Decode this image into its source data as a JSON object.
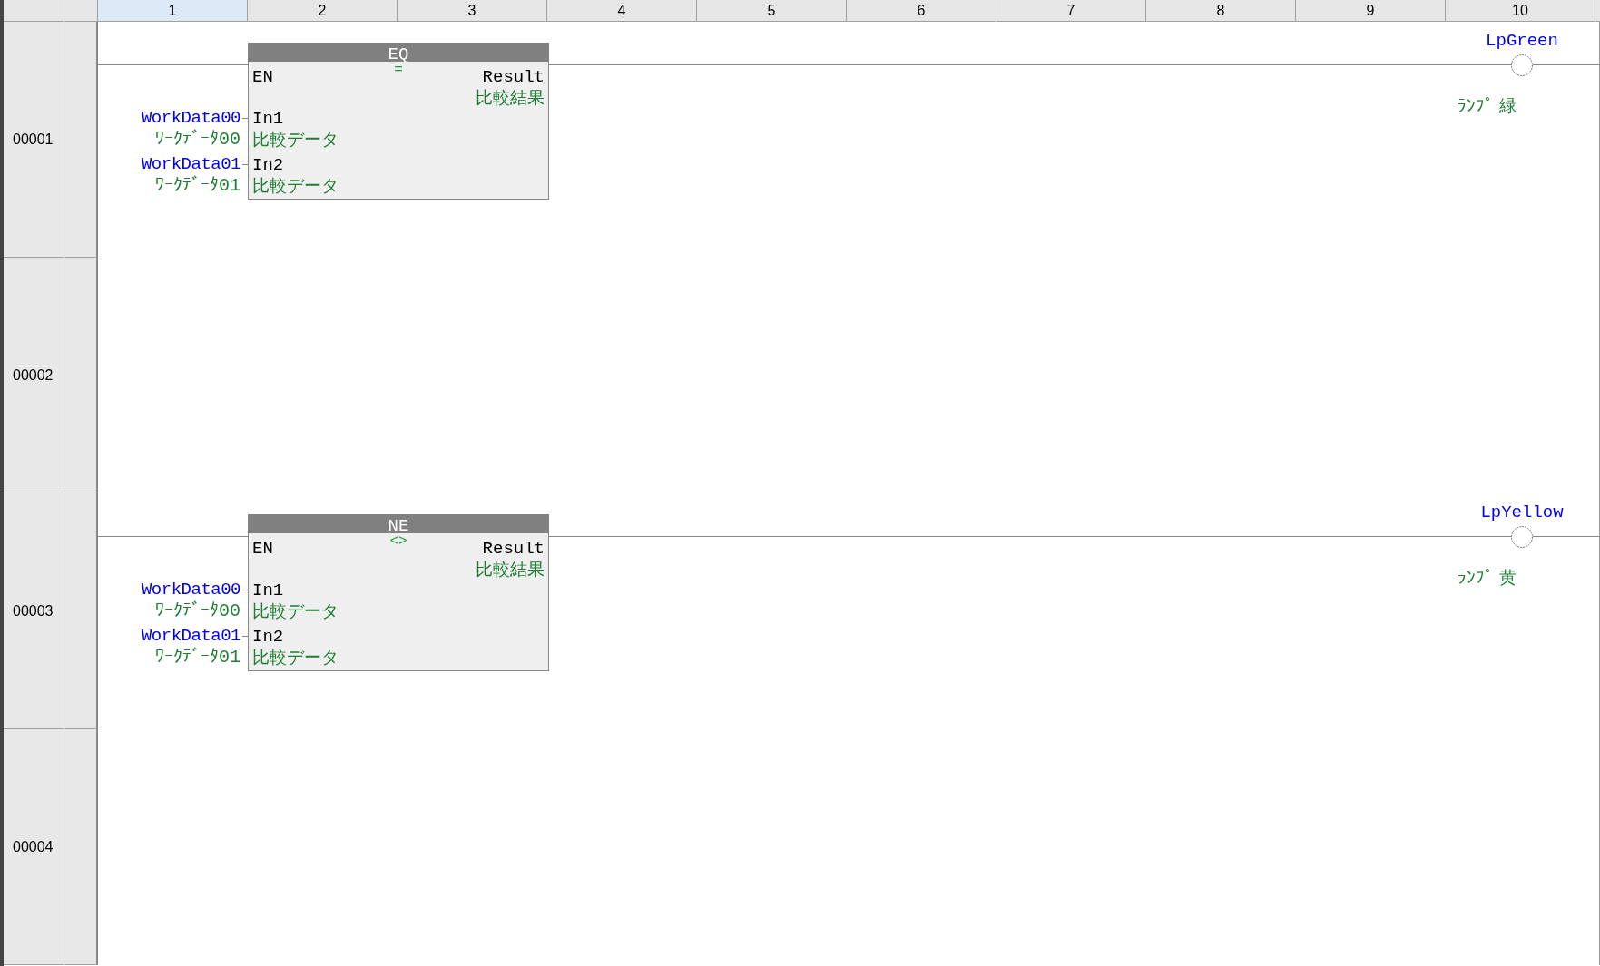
{
  "columns": [
    {
      "label": "1",
      "selected": true
    },
    {
      "label": "2",
      "selected": false
    },
    {
      "label": "3",
      "selected": false
    },
    {
      "label": "4",
      "selected": false
    },
    {
      "label": "5",
      "selected": false
    },
    {
      "label": "6",
      "selected": false
    },
    {
      "label": "7",
      "selected": false
    },
    {
      "label": "8",
      "selected": false
    },
    {
      "label": "9",
      "selected": false
    },
    {
      "label": "10",
      "selected": false
    }
  ],
  "rungs": [
    {
      "number": "00001",
      "block": {
        "title": "EQ",
        "symbol": "=",
        "enable": "EN",
        "output": "Result",
        "output_comment": "比較結果",
        "inputs": [
          {
            "pin": "In1",
            "pin_comment": "比較データ",
            "variable": "WorkData00",
            "variable_comment": "ﾜｰｸﾃﾞｰﾀ00"
          },
          {
            "pin": "In2",
            "pin_comment": "比較データ",
            "variable": "WorkData01",
            "variable_comment": "ﾜｰｸﾃﾞｰﾀ01"
          }
        ]
      },
      "coil": {
        "variable": "LpGreen",
        "comment": "ﾗﾝﾌﾟ 緑"
      }
    },
    {
      "number": "00002"
    },
    {
      "number": "00003",
      "block": {
        "title": "NE",
        "symbol": "<>",
        "enable": "EN",
        "output": "Result",
        "output_comment": "比較結果",
        "inputs": [
          {
            "pin": "In1",
            "pin_comment": "比較データ",
            "variable": "WorkData00",
            "variable_comment": "ﾜｰｸﾃﾞｰﾀ00"
          },
          {
            "pin": "In2",
            "pin_comment": "比較データ",
            "variable": "WorkData01",
            "variable_comment": "ﾜｰｸﾃﾞｰﾀ01"
          }
        ]
      },
      "coil": {
        "variable": "LpYellow",
        "comment": "ﾗﾝﾌﾟ 黄"
      }
    },
    {
      "number": "00004"
    }
  ]
}
